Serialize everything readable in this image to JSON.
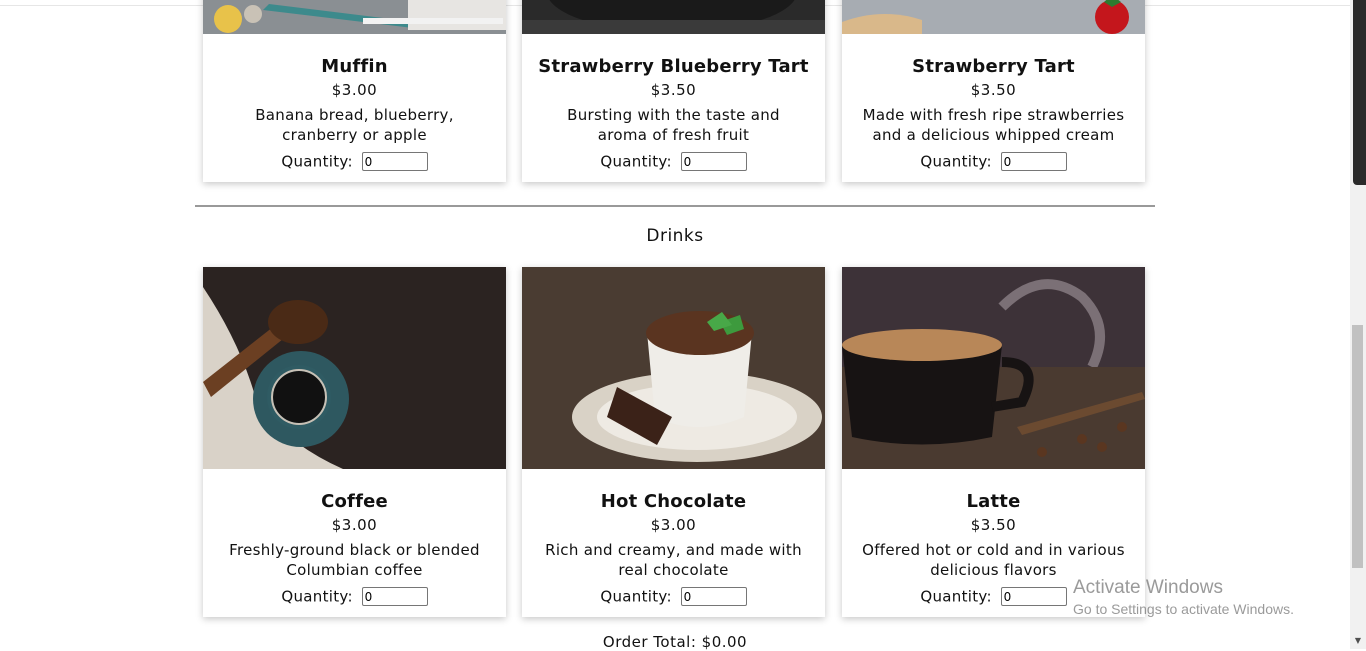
{
  "pastries": {
    "items": [
      {
        "name": "Muffin",
        "price": "$3.00",
        "desc": "Banana bread, blueberry, cranberry or apple",
        "qty_label": "Quantity:",
        "qty_value": "0"
      },
      {
        "name": "Strawberry Blueberry Tart",
        "price": "$3.50",
        "desc": "Bursting with the taste and aroma of fresh fruit",
        "qty_label": "Quantity:",
        "qty_value": "0"
      },
      {
        "name": "Strawberry Tart",
        "price": "$3.50",
        "desc": "Made with fresh ripe strawberries and a delicious whipped cream",
        "qty_label": "Quantity:",
        "qty_value": "0"
      }
    ]
  },
  "drinks": {
    "title": "Drinks",
    "items": [
      {
        "name": "Coffee",
        "price": "$3.00",
        "desc": "Freshly-ground black or blended Columbian coffee",
        "qty_label": "Quantity:",
        "qty_value": "0"
      },
      {
        "name": "Hot Chocolate",
        "price": "$3.00",
        "desc": "Rich and creamy, and made with real chocolate",
        "qty_label": "Quantity:",
        "qty_value": "0"
      },
      {
        "name": "Latte",
        "price": "$3.50",
        "desc": "Offered hot or cold and in various delicious flavors",
        "qty_label": "Quantity:",
        "qty_value": "0"
      }
    ]
  },
  "order": {
    "total_label": "Order Total:",
    "total_value": "$0.00"
  },
  "watermark": {
    "title": "Activate Windows",
    "subtitle": "Go to Settings to activate Windows."
  },
  "colors": {
    "divider": "#999999",
    "card_shadow": "rgba(0,0,0,0.22)",
    "background": "#ffffff"
  }
}
